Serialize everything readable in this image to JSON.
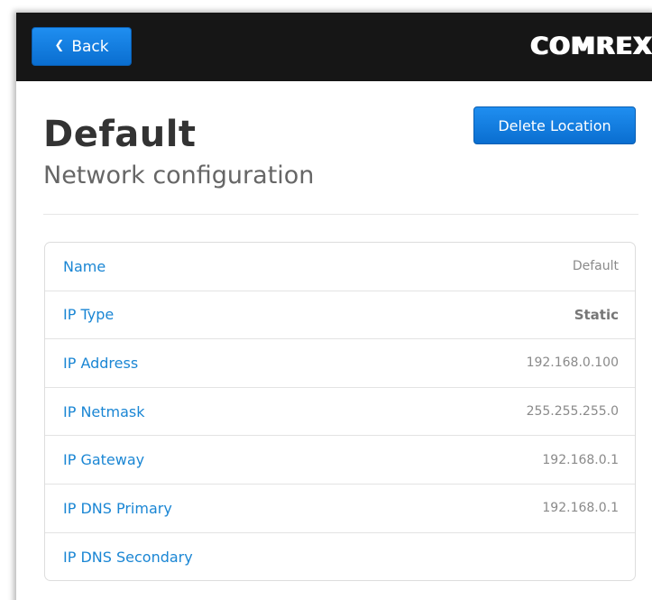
{
  "topbar": {
    "back_label": "Back",
    "logo_text": "COMREX"
  },
  "page": {
    "title": "Default",
    "subtitle": "Network configuration",
    "delete_label": "Delete Location"
  },
  "rows": [
    {
      "label": "Name",
      "value": "Default"
    },
    {
      "label": "IP Type",
      "value": "Static"
    },
    {
      "label": "IP Address",
      "value": "192.168.0.100"
    },
    {
      "label": "IP Netmask",
      "value": "255.255.255.0"
    },
    {
      "label": "IP Gateway",
      "value": "192.168.0.1"
    },
    {
      "label": "IP DNS Primary",
      "value": "192.168.0.1"
    },
    {
      "label": "IP DNS Secondary",
      "value": ""
    }
  ],
  "colors": {
    "accent_blue": "#0a6ed0",
    "link_blue": "#1a86d4",
    "topbar": "#161616"
  }
}
